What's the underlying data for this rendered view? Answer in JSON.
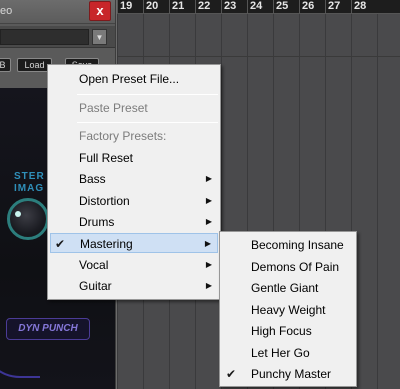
{
  "plugin": {
    "title": "eo",
    "close_label": "x",
    "buttons": [
      "B",
      "Load",
      "Save"
    ],
    "stereo_label": "STER\nIMAG",
    "dyn_punch_label": "DYN PUNCH"
  },
  "timeline": {
    "ruler": [
      "19",
      "20",
      "21",
      "22",
      "23",
      "24",
      "25",
      "26",
      "27",
      "28"
    ]
  },
  "menu": {
    "open_preset": "Open Preset File...",
    "paste_preset": "Paste Preset",
    "factory_header": "Factory Presets:",
    "full_reset": "Full Reset",
    "categories": [
      "Bass",
      "Distortion",
      "Drums",
      "Mastering",
      "Vocal",
      "Guitar"
    ],
    "checked_category": "Mastering"
  },
  "submenu": {
    "items": [
      "Becoming Insane",
      "Demons Of Pain",
      "Gentle Giant",
      "Heavy Weight",
      "High Focus",
      "Let Her Go",
      "Punchy Master"
    ],
    "checked_item": "Punchy Master"
  },
  "icons": {
    "check": "checkmark-icon",
    "submenu_arrow": "triangle-right-icon",
    "dropdown": "triangle-down-icon"
  },
  "colors": {
    "close_button": "#c8262a",
    "menu_highlight": "#cfe0f4",
    "accent_teal": "#2c7e7d",
    "accent_purple": "#4b3c96"
  }
}
